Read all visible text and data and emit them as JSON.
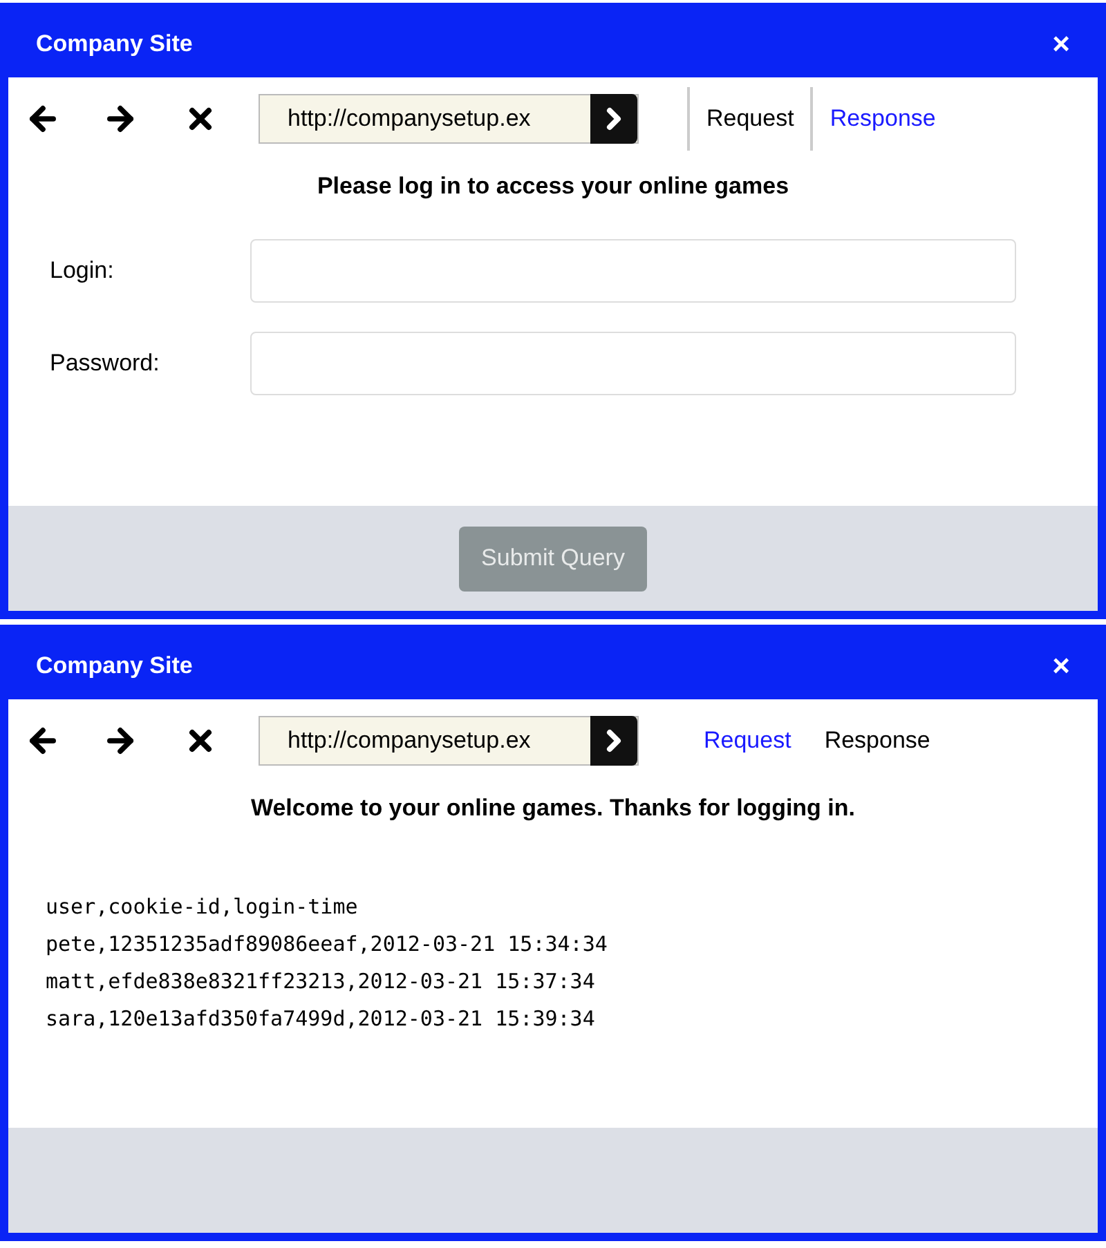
{
  "windows": [
    {
      "kind": "login",
      "title": "Company Site",
      "close": "×",
      "url": "http://companysetup.ex",
      "tabs": [
        {
          "label": "Request",
          "selected": true
        },
        {
          "label": "Response",
          "selected": false
        }
      ],
      "heading": "Please log in to access your online games",
      "fields": [
        {
          "label": "Login:"
        },
        {
          "label": "Password:"
        }
      ],
      "submit": {
        "label": "Submit Query",
        "disabled": true
      }
    },
    {
      "kind": "result",
      "title": "Company Site",
      "close": "×",
      "url": "http://companysetup.ex",
      "tabs": [
        {
          "label": "Request",
          "selected": false
        },
        {
          "label": "Response",
          "selected": true
        }
      ],
      "heading": "Welcome to your online games. Thanks for logging in.",
      "lines": [
        "user,cookie-id,login-time",
        "pete,12351235adf89086eeaf,2012-03-21 15:34:34",
        "matt,efde838e8321ff23213,2012-03-21 15:37:34",
        "sara,120e13afd350fa7499d,2012-03-21 15:39:34"
      ]
    }
  ]
}
